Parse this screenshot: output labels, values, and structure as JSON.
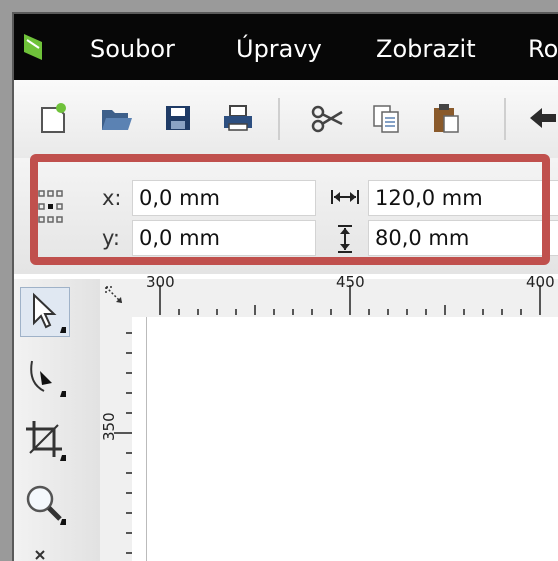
{
  "menu": {
    "items": [
      {
        "label": "Soubor"
      },
      {
        "label": "Úpravy"
      },
      {
        "label": "Zobrazit"
      },
      {
        "label": "Ro"
      }
    ]
  },
  "toolbar": {
    "buttons": [
      "new-document-icon",
      "open-folder-icon",
      "save-icon",
      "print-icon",
      "cut-icon",
      "copy-icon",
      "paste-icon",
      "undo-icon"
    ]
  },
  "properties": {
    "x_label": "x:",
    "x_value": "0,0 mm",
    "y_label": "y:",
    "y_value": "0,0 mm",
    "width_value": "120,0 mm",
    "height_value": "80,0 mm"
  },
  "ruler": {
    "top_ticks": [
      "300",
      "450",
      "400"
    ],
    "left_tick": "350"
  },
  "colors": {
    "highlight": "#c0504d",
    "menubar": "#070707",
    "logo_green": "#6fc23a"
  }
}
